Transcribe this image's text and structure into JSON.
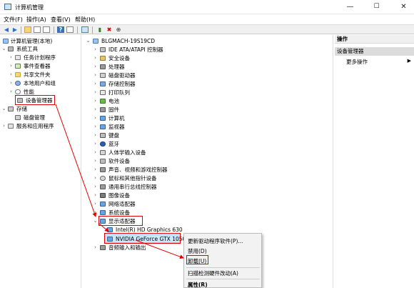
{
  "window": {
    "title": "计算机管理",
    "minimize": "—",
    "maximize": "☐",
    "close": "✕"
  },
  "menu": [
    "文件(F)",
    "操作(A)",
    "查看(V)",
    "帮助(H)"
  ],
  "left": {
    "root": "计算机管理(本地)",
    "system_tools": "系统工具",
    "task_scheduler": "任务计划程序",
    "event_viewer": "事件查看器",
    "shared_folders": "共享文件夹",
    "local_users": "本地用户和组",
    "performance": "性能",
    "device_manager": "设备管理器",
    "storage": "存储",
    "disk_mgmt": "磁盘管理",
    "services": "服务和应用程序"
  },
  "devices": {
    "computer": "BLGMACH-19S19CD",
    "ide": "IDE ATA/ATAPI 控制器",
    "security": "安全设备",
    "cpu": "处理器",
    "disk": "磁盘驱动器",
    "storage_ctrl": "存储控制器",
    "print_queue": "打印队列",
    "battery": "电池",
    "firmware": "固件",
    "computer_node": "计算机",
    "monitor": "监视器",
    "keyboard": "键盘",
    "bluetooth": "蓝牙",
    "hid": "人体学输入设备",
    "software": "软件设备",
    "sound": "声音、视频和游戏控制器",
    "mouse": "鼠标和其他指针设备",
    "usb": "通用串行总线控制器",
    "imaging": "图像设备",
    "network": "网络适配器",
    "system": "系统设备",
    "display": "显示适配器",
    "intel": "Intel(R) HD Graphics 630",
    "nvidia": "NVIDIA GeForce GTX 1050",
    "audio_io": "音频输入和输出"
  },
  "actions": {
    "header": "操作",
    "section": "设备管理器",
    "more": "更多操作"
  },
  "context_menu": {
    "update": "更新驱动程序软件(P)...",
    "disable": "禁用(D)",
    "uninstall": "卸载(U)",
    "scan": "扫描检测硬件改动(A)",
    "properties": "属性(R)"
  }
}
